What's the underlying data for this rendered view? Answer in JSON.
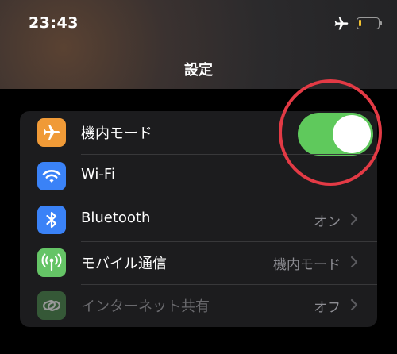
{
  "status_bar": {
    "time": "23:43",
    "airplane_icon": "airplane-icon",
    "battery_level": 0.15,
    "battery_color": "#f2c230"
  },
  "nav": {
    "title": "設定"
  },
  "settings": {
    "rows": [
      {
        "label": "機内モード",
        "icon": "airplane-icon",
        "icon_bg": "#f09a37",
        "control": "toggle",
        "toggle_on": true,
        "toggle_color": "#5fc95c"
      },
      {
        "label": "Wi-Fi",
        "icon": "wifi-icon",
        "icon_bg": "#3a82f7"
      },
      {
        "label": "Bluetooth",
        "icon": "bluetooth-icon",
        "icon_bg": "#3a82f7",
        "value": "オン"
      },
      {
        "label": "モバイル通信",
        "icon": "cellular-antenna-icon",
        "icon_bg": "#65c466",
        "value": "機内モード"
      },
      {
        "label": "インターネット共有",
        "icon": "personal-hotspot-icon",
        "icon_bg": "#4b8a4d",
        "value": "オフ",
        "dimmed": true
      }
    ]
  },
  "annotation": {
    "color": "#e33a45",
    "target": "airplane-mode-toggle"
  }
}
